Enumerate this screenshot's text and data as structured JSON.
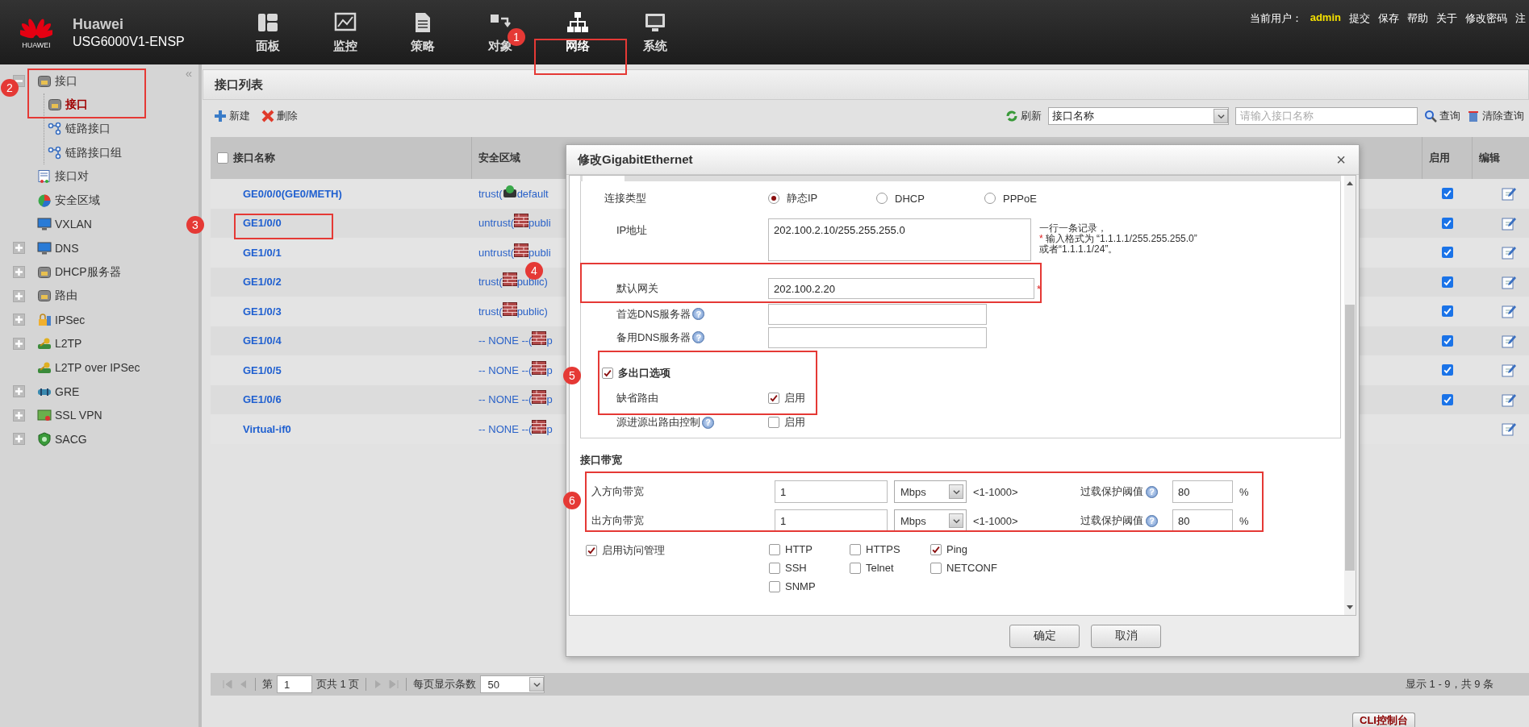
{
  "header": {
    "logo_text": "HUAWEI",
    "brand": "Huawei",
    "model": "USG6000V1-ENSP",
    "nav": [
      {
        "label": "面板",
        "selected": false
      },
      {
        "label": "监控",
        "selected": false
      },
      {
        "label": "策略",
        "selected": false
      },
      {
        "label": "对象",
        "selected": false
      },
      {
        "label": "网络",
        "selected": true
      },
      {
        "label": "系统",
        "selected": false
      }
    ],
    "user_label": "当前用户：",
    "user": "admin",
    "links": [
      "提交",
      "保存",
      "帮助",
      "关于",
      "修改密码",
      "注"
    ]
  },
  "sidebar": {
    "collapse": "«",
    "items": [
      {
        "label": "接口",
        "selected": false,
        "expanded": true,
        "children": [
          {
            "label": "接口",
            "selected": true
          },
          {
            "label": "链路接口",
            "selected": false
          },
          {
            "label": "链路接口组",
            "selected": false
          }
        ]
      },
      {
        "label": "接口对",
        "selected": false
      },
      {
        "label": "安全区域",
        "selected": false
      },
      {
        "label": "VXLAN",
        "selected": false
      },
      {
        "label": "DNS",
        "selected": false,
        "expanded": false
      },
      {
        "label": "DHCP服务器",
        "selected": false,
        "expanded": false
      },
      {
        "label": "路由",
        "selected": false,
        "expanded": false
      },
      {
        "label": "IPSec",
        "selected": false,
        "expanded": false
      },
      {
        "label": "L2TP",
        "selected": false,
        "expanded": false
      },
      {
        "label": "L2TP over IPSec",
        "selected": false
      },
      {
        "label": "GRE",
        "selected": false,
        "expanded": false
      },
      {
        "label": "SSL VPN",
        "selected": false,
        "expanded": false
      },
      {
        "label": "SACG",
        "selected": false,
        "expanded": false
      }
    ]
  },
  "panel": {
    "title": "接口列表",
    "new": "新建",
    "delete": "删除",
    "refresh": "刷新",
    "filter_select": "接口名称",
    "filter_placeholder": "请输入接口名称",
    "search": "查询",
    "clear": "清除查询"
  },
  "table": {
    "select_all_checked": false,
    "columns": [
      "接口名称",
      "安全区域",
      "启用",
      "编辑"
    ],
    "rows": [
      {
        "name": "GE0/0/0(GE0/METH)",
        "zone": "trust(",
        "zone_tail": "default",
        "enabled": true
      },
      {
        "name": "GE1/0/0",
        "zone": "untrust(",
        "zone_tail": "publi",
        "enabled": true
      },
      {
        "name": "GE1/0/1",
        "zone": "untrust(",
        "zone_tail": "publi",
        "enabled": true
      },
      {
        "name": "GE1/0/2",
        "zone": "trust(",
        "zone_tail": "public)",
        "enabled": true
      },
      {
        "name": "GE1/0/3",
        "zone": "trust(",
        "zone_tail": "public)",
        "enabled": true
      },
      {
        "name": "GE1/0/4",
        "zone": "-- NONE --(",
        "zone_tail": "p",
        "enabled": true
      },
      {
        "name": "GE1/0/5",
        "zone": "-- NONE --(",
        "zone_tail": "p",
        "enabled": true
      },
      {
        "name": "GE1/0/6",
        "zone": "-- NONE --(",
        "zone_tail": "p",
        "enabled": true
      },
      {
        "name": "Virtual-if0",
        "zone": "-- NONE --(",
        "zone_tail": "p"
      }
    ]
  },
  "pager": {
    "page_label": "第",
    "page": "1",
    "total": "页共 1 页",
    "per_page_label": "每页显示条数",
    "per_page": "50",
    "summary": "显示 1 - 9，共 9 条"
  },
  "cli_button": "CLI控制台",
  "dialog": {
    "title": "修改GigabitEthernet",
    "close": "×",
    "connection": {
      "label": "连接类型",
      "options": [
        {
          "label": "静态IP",
          "selected": true
        },
        {
          "label": "DHCP",
          "selected": false
        },
        {
          "label": "PPPoE",
          "selected": false
        }
      ]
    },
    "ip": {
      "label": "IP地址",
      "value": "202.100.2.10/255.255.255.0",
      "hint": [
        {
          "text": "一行一条记录，"
        },
        {
          "mark": "*",
          "text": "输入格式为 “1.1.1.1/255.255.255.0”"
        },
        {
          "text": "或者“1.1.1.1/24”。"
        }
      ]
    },
    "gateway": {
      "label": "默认网关",
      "value": "202.100.2.20",
      "mark": "*"
    },
    "dns": [
      {
        "label": "首选DNS服务器",
        "help": "?"
      },
      {
        "label": "备用DNS服务器",
        "help": "?"
      }
    ],
    "multi_exit": {
      "label": "多出口选项",
      "checked": true
    },
    "routes": [
      {
        "label": "缺省路由",
        "option": "启用",
        "checked": true
      },
      {
        "label": "源进源出路由控制",
        "help": "?",
        "option": "启用",
        "checked": false
      }
    ],
    "bandwidth": {
      "title": "接口带宽",
      "rows": [
        {
          "label": "入方向带宽",
          "value": "1",
          "unit": "Mbps",
          "range": "<1-1000>",
          "threshold_label": "过载保护阈值",
          "help": "?",
          "threshold": "80",
          "percent": "%"
        },
        {
          "label": "出方向带宽",
          "value": "1",
          "unit": "Mbps",
          "range": "<1-1000>",
          "threshold_label": "过载保护阈值",
          "help": "?",
          "threshold": "80",
          "percent": "%"
        }
      ]
    },
    "access": {
      "label": "启用访问管理",
      "checked": true,
      "services": [
        {
          "label": "HTTP",
          "checked": false
        },
        {
          "label": "HTTPS",
          "checked": false
        },
        {
          "label": "Ping",
          "checked": true
        },
        {
          "label": "SSH",
          "checked": false
        },
        {
          "label": "Telnet",
          "checked": false
        },
        {
          "label": "NETCONF",
          "checked": false
        },
        {
          "label": "SNMP",
          "checked": false
        }
      ]
    },
    "buttons": [
      "确定",
      "取消"
    ]
  },
  "annotations": [
    {
      "label": "1"
    },
    {
      "label": "2"
    },
    {
      "label": "3"
    },
    {
      "label": "4"
    },
    {
      "label": "5"
    },
    {
      "label": "6"
    }
  ]
}
